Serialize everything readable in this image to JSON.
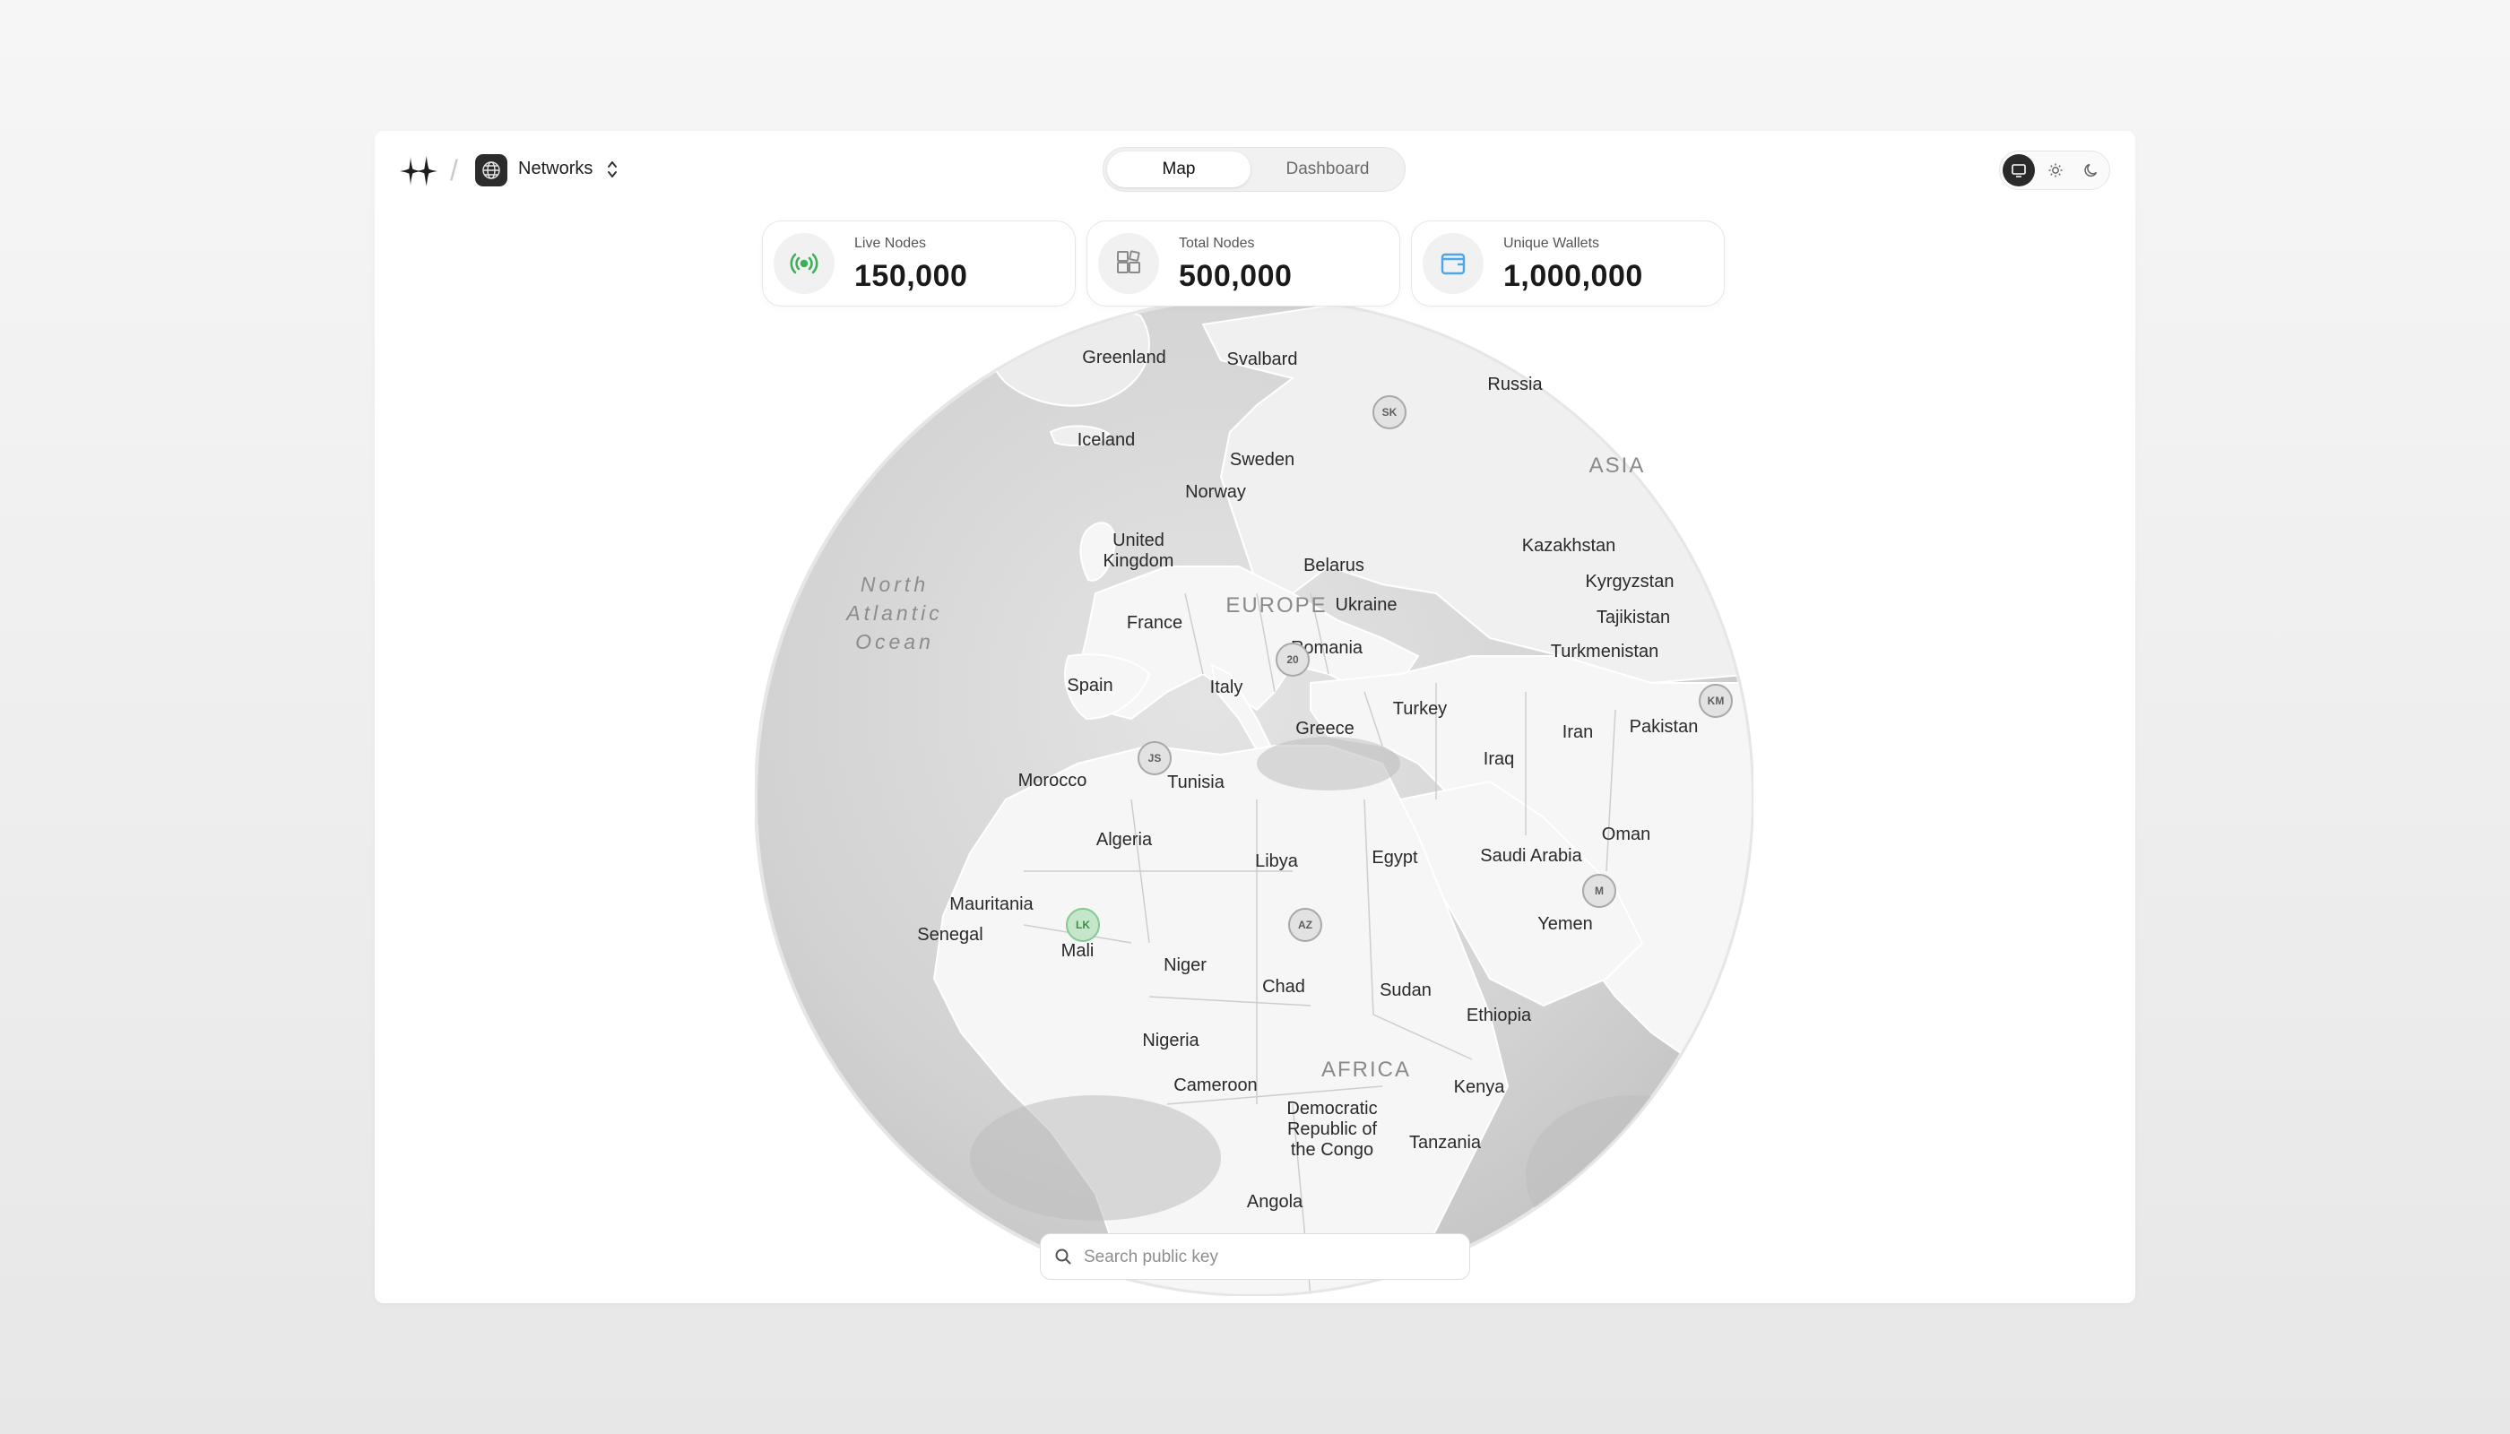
{
  "header": {
    "separator": "/",
    "network_label": "Networks",
    "brand_icon": "sparkle-logo-icon",
    "network_icon": "globe-icon"
  },
  "tabs": [
    {
      "label": "Map",
      "active": true
    },
    {
      "label": "Dashboard",
      "active": false
    }
  ],
  "theme_switch": [
    "monitor-icon",
    "sun-icon",
    "moon-icon"
  ],
  "stats": [
    {
      "label": "Live Nodes",
      "value": "150,000",
      "icon": "broadcast-icon",
      "accent": "#3fae5a"
    },
    {
      "label": "Total Nodes",
      "value": "500,000",
      "icon": "grid-icon",
      "accent": "#8a8a8a"
    },
    {
      "label": "Unique Wallets",
      "value": "1,000,000",
      "icon": "wallet-icon",
      "accent": "#4aa8e8"
    }
  ],
  "map": {
    "labels": {
      "greenland": "Greenland",
      "svalbard": "Svalbard",
      "russia": "Russia",
      "iceland": "Iceland",
      "sweden": "Sweden",
      "norway": "Norway",
      "asia": "ASIA",
      "uk": "United\nKingdom",
      "belarus": "Belarus",
      "kazakhstan": "Kazakhstan",
      "kyrgyzstan": "Kyrgyzstan",
      "tajikistan": "Tajikistan",
      "ocean": "North\nAtlantic\nOcean",
      "france": "France",
      "europe": "EUROPE",
      "ukraine": "Ukraine",
      "romania": "Romania",
      "turkmenistan": "Turkmenistan",
      "spain": "Spain",
      "italy": "Italy",
      "turkey": "Turkey",
      "greece": "Greece",
      "iran": "Iran",
      "pakistan": "Pakistan",
      "iraq": "Iraq",
      "morocco": "Morocco",
      "tunisia": "Tunisia",
      "algeria": "Algeria",
      "libya": "Libya",
      "egypt": "Egypt",
      "saudi": "Saudi Arabia",
      "oman": "Oman",
      "mauritania": "Mauritania",
      "senegal": "Senegal",
      "mali": "Mali",
      "yemen": "Yemen",
      "niger": "Niger",
      "chad": "Chad",
      "sudan": "Sudan",
      "ethiopia": "Ethiopia",
      "nigeria": "Nigeria",
      "africa": "AFRICA",
      "cameroon": "Cameroon",
      "kenya": "Kenya",
      "drc": "Democratic\nRepublic of\nthe Congo",
      "tanzania": "Tanzania",
      "angola": "Angola"
    },
    "markers": [
      {
        "initials": "SK",
        "live": false
      },
      {
        "initials": "20",
        "live": false
      },
      {
        "initials": "KM",
        "live": false
      },
      {
        "initials": "JS",
        "live": false
      },
      {
        "initials": "M",
        "live": false
      },
      {
        "initials": "LK",
        "live": true
      },
      {
        "initials": "AZ",
        "live": false
      }
    ]
  },
  "search": {
    "placeholder": "Search public key",
    "value": "",
    "icon": "search-icon"
  }
}
